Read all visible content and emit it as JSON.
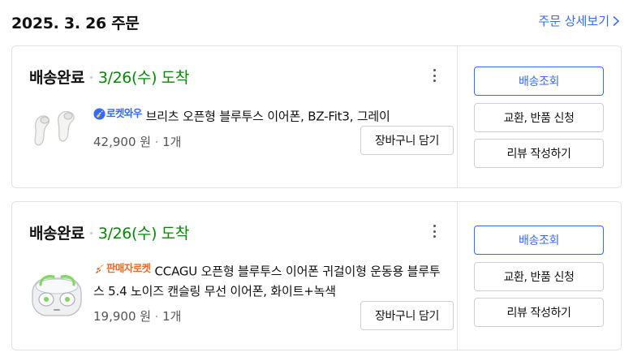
{
  "header": {
    "order_date": "2025. 3. 26 주문",
    "detail_link": "주문 상세보기"
  },
  "orders": [
    {
      "status": "배송완료",
      "arrival": "3/26(수) 도착",
      "badge": "로켓와우",
      "badge_icon": "rocket-wow-icon",
      "product_name": "브리츠 오픈형 블루투스 이어폰, BZ-Fit3, 그레이",
      "price": "42,900 원",
      "quantity": "1개",
      "cart_button": "장바구니 담기",
      "actions": [
        "배송조회",
        "교환, 반품 신청",
        "리뷰 작성하기"
      ]
    },
    {
      "status": "배송완료",
      "arrival": "3/26(수) 도착",
      "badge": "판매자로켓",
      "badge_icon": "rocket-seller-icon",
      "product_name": "CCAGU 오픈형 블루투스 이어폰 귀걸이형 운동용 블루투스 5.4 노이즈 캔슬링 무선 이어폰, 화이트+녹색",
      "price": "19,900 원",
      "quantity": "1개",
      "cart_button": "장바구니 담기",
      "actions": [
        "배송조회",
        "교환, 반품 신청",
        "리뷰 작성하기"
      ]
    }
  ],
  "colors": {
    "accent": "#346aff",
    "arrival": "#008c00",
    "seller_badge": "#f26722",
    "border": "#dfe3e8"
  }
}
